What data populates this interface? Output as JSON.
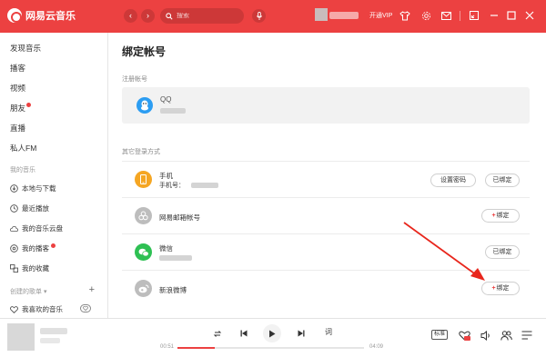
{
  "app": {
    "name": "网易云音乐",
    "back": "‹",
    "forward": "›",
    "search_placeholder": "搜索",
    "vip_label": "开通VIP",
    "accent_color": "#ec4141"
  },
  "sidebar": {
    "items": [
      {
        "label": "发现音乐"
      },
      {
        "label": "播客"
      },
      {
        "label": "视频"
      },
      {
        "label": "朋友"
      },
      {
        "label": "直播"
      },
      {
        "label": "私人FM"
      }
    ],
    "my_music_heading": "我的音乐",
    "my_music": [
      {
        "label": "本地与下载",
        "icon": "download-icon"
      },
      {
        "label": "最近播放",
        "icon": "clock-icon"
      },
      {
        "label": "我的音乐云盘",
        "icon": "cloud-icon"
      },
      {
        "label": "我的播客",
        "icon": "podcast-icon"
      },
      {
        "label": "我的收藏",
        "icon": "collect-icon"
      }
    ],
    "created_heading": "创建的歌单",
    "created_arrow": "▾",
    "add": "+",
    "liked": "我喜欢的音乐"
  },
  "main": {
    "title": "绑定帐号",
    "registered_label": "注册帐号",
    "registered_name": "QQ",
    "other_label": "其它登录方式",
    "rows": [
      {
        "label": "手机",
        "sub": "手机号：",
        "button1": "设置密码",
        "button2": "已绑定",
        "icon": "phone-icon"
      },
      {
        "label": "网易邮箱帐号",
        "button": "绑定",
        "icon": "netease-mail-icon"
      },
      {
        "label": "微信",
        "button": "已绑定",
        "icon": "wechat-icon"
      },
      {
        "label": "新浪微博",
        "button": "绑定",
        "icon": "weibo-icon"
      }
    ]
  },
  "player": {
    "current_time": "00:51",
    "total_time": "04:09",
    "progress": 0.2,
    "lyric": "词",
    "quality": "标准"
  }
}
